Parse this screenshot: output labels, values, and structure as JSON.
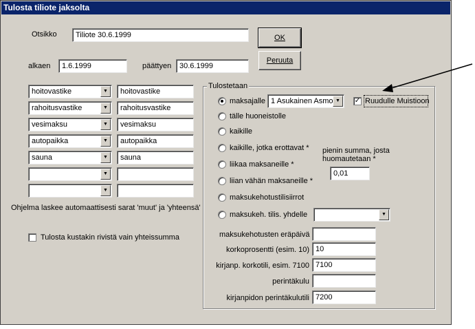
{
  "window": {
    "title": "Tulosta tiliote jaksolta"
  },
  "header": {
    "title_label": "Otsikko",
    "title_value": "Tiliote 30.6.1999",
    "start_label": "alkaen",
    "start_value": "1.6.1999",
    "end_label": "päättyen",
    "end_value": "30.6.1999"
  },
  "buttons": {
    "ok": "OK",
    "cancel": "Peruuta"
  },
  "charges": {
    "rows": [
      {
        "select": "hoitovastike",
        "label": "hoitovastike"
      },
      {
        "select": "rahoitusvastike",
        "label": "rahoitusvastike"
      },
      {
        "select": "vesimaksu",
        "label": "vesimaksu"
      },
      {
        "select": "autopaikka",
        "label": "autopaikka"
      },
      {
        "select": "sauna",
        "label": "sauna"
      },
      {
        "select": "",
        "label": ""
      },
      {
        "select": "",
        "label": ""
      }
    ],
    "note": "Ohjelma laskee automaattisesti sarat 'muut' ja 'yhteensä'",
    "sum_only_label": "Tulosta kustakin rivistä vain yhteissumma",
    "sum_only_checked": false
  },
  "print_group": {
    "legend": "Tulostetaan",
    "payer_label": "maksajalle",
    "payer_value": "1 Asukainen Asmo",
    "screen_memo_label": "Ruudulle Muistioon",
    "screen_memo_checked": true,
    "options": [
      "tälle huoneistolle",
      "kaikille",
      "kaikille, jotka erottavat *",
      "liikaa maksaneille *",
      "liian vähän maksaneille *",
      "maksukehotustilisiirrot",
      "maksukeh. tilis. yhdelle"
    ],
    "selected_option": "maksajalle",
    "min_sum_label": "pienin summa, josta huomautetaan *",
    "min_sum_value": "0,01",
    "single_account_value": "",
    "reminder_due_label": "maksukehotusten eräpäivä",
    "reminder_due_value": "",
    "interest_label": "korkoprosentti (esim. 10)",
    "interest_value": "10",
    "interest_account_label": "kirjanp. korkotili, esim. 7100",
    "interest_account_value": "7100",
    "collection_fee_label": "perintäkulu",
    "collection_fee_value": "",
    "collection_account_label": "kirjanpidon perintäkulutili",
    "collection_account_value": "7200"
  },
  "colors": {
    "face": "#d4d0c8",
    "title_bar": "#0a246a"
  },
  "icons": {
    "annotation": "arrow-annotation-icon",
    "dropdown": "chevron-down-icon"
  }
}
